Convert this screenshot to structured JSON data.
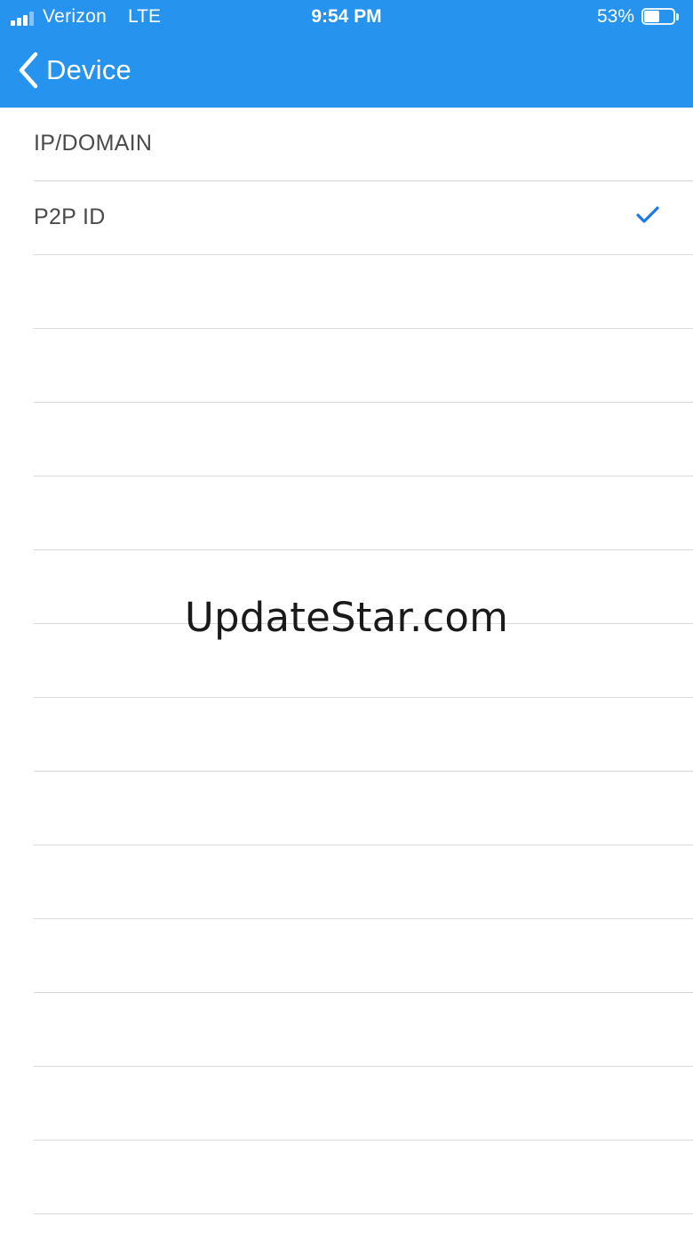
{
  "status_bar": {
    "carrier": "Verizon",
    "network": "LTE",
    "time": "9:54 PM",
    "battery_percent": "53%",
    "battery_level": 0.53
  },
  "nav": {
    "back_label": "Device",
    "back_icon": "chevron-left-icon"
  },
  "options": [
    {
      "label": "IP/DOMAIN",
      "selected": false
    },
    {
      "label": "P2P ID",
      "selected": true
    }
  ],
  "empty_row_count": 13,
  "watermark": "UpdateStar.com",
  "colors": {
    "header": "#2693ee",
    "checkmark": "#1a7ae0",
    "separator": "#d9d9d9",
    "label_text": "#4a4a4a"
  }
}
